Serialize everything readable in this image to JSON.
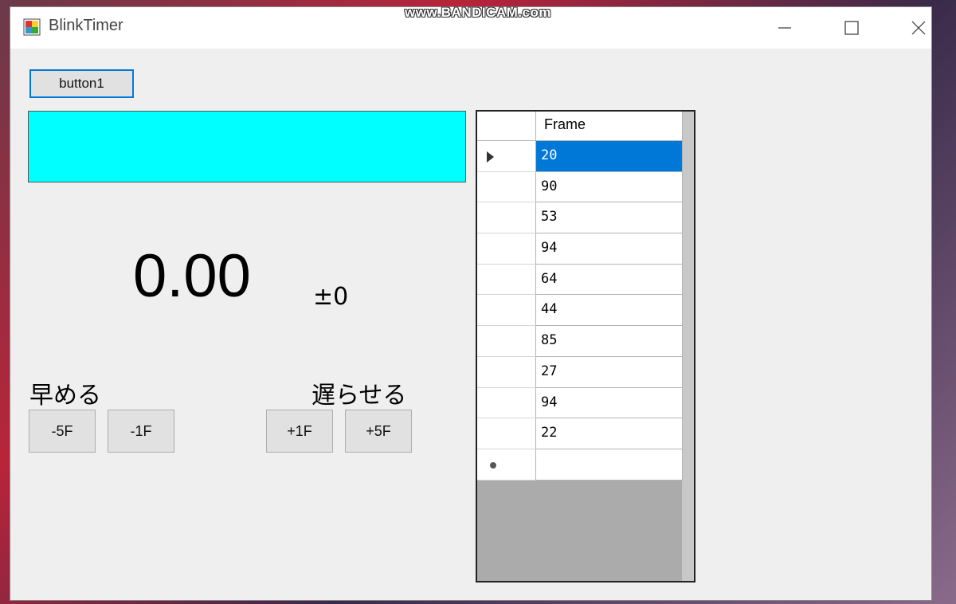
{
  "watermark": "www.BANDICAM.com",
  "window": {
    "title": "BlinkTimer",
    "icon": "app-window-icon"
  },
  "controls": {
    "button1_label": "button1",
    "timer_value": "0.00",
    "offset_value": "±0",
    "earlier_label": "早める",
    "later_label": "遅らせる",
    "btn_minus5": "-5F",
    "btn_minus1": "-1F",
    "btn_plus1": "+1F",
    "btn_plus5": "+5F",
    "panel_color": "#00ffff"
  },
  "grid": {
    "column_header": "Frame",
    "rows": [
      "20",
      "90",
      "53",
      "94",
      "64",
      "44",
      "85",
      "27",
      "94",
      "22"
    ],
    "selected_row_index": 0,
    "selection_color": "#0078d7"
  }
}
